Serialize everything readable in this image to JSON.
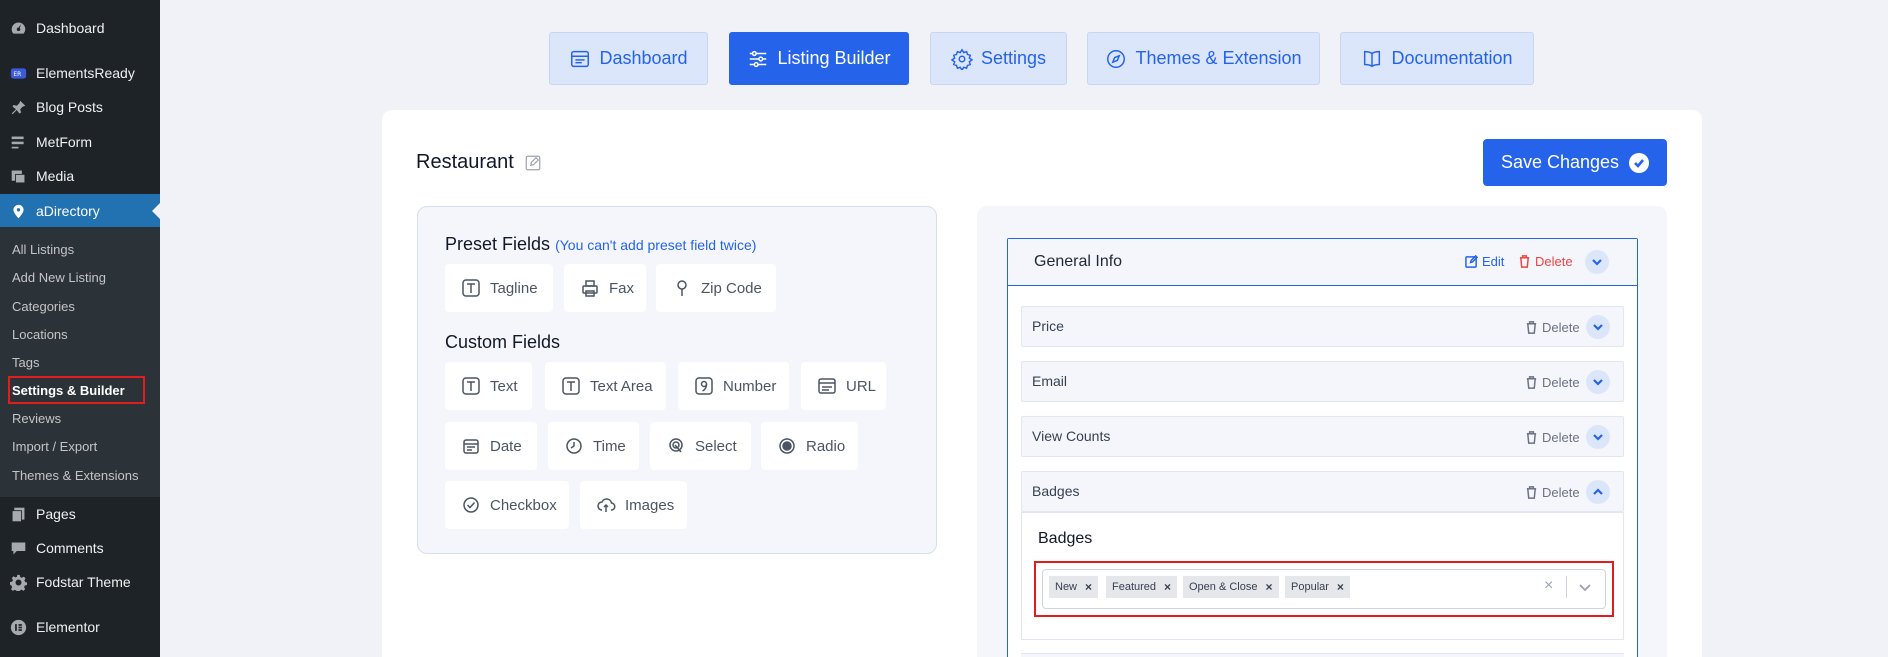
{
  "sidebar": {
    "items": [
      {
        "label": "Dashboard",
        "icon": "dashboard-icon"
      },
      {
        "label": "ElementsReady",
        "icon": "elementsready-icon"
      },
      {
        "label": "Blog Posts",
        "icon": "pin-icon"
      },
      {
        "label": "MetForm",
        "icon": "form-icon"
      },
      {
        "label": "Media",
        "icon": "media-icon"
      },
      {
        "label": "aDirectory",
        "icon": "location-icon"
      },
      {
        "label": "Pages",
        "icon": "pages-icon"
      },
      {
        "label": "Comments",
        "icon": "comments-icon"
      },
      {
        "label": "Fodstar Theme",
        "icon": "gear-icon"
      },
      {
        "label": "Elementor",
        "icon": "elementor-icon"
      }
    ],
    "submenu": [
      "All Listings",
      "Add New Listing",
      "Categories",
      "Locations",
      "Tags",
      "Settings & Builder",
      "Reviews",
      "Import / Export",
      "Themes & Extensions"
    ]
  },
  "topnav": {
    "tabs": [
      "Dashboard",
      "Listing Builder",
      "Settings",
      "Themes & Extension",
      "Documentation"
    ]
  },
  "builder": {
    "title": "Restaurant",
    "save_label": "Save Changes",
    "preset": {
      "heading": "Preset Fields",
      "note": "(You can't add preset field twice)",
      "chips": [
        "Tagline",
        "Fax",
        "Zip Code"
      ]
    },
    "custom": {
      "heading": "Custom Fields",
      "chips": [
        "Text",
        "Text Area",
        "Number",
        "URL",
        "Date",
        "Time",
        "Select",
        "Radio",
        "Checkbox",
        "Images"
      ]
    },
    "group": {
      "title": "General Info",
      "edit_label": "Edit",
      "delete_label": "Delete",
      "fields": [
        "Price",
        "Email",
        "View Counts",
        "Badges"
      ],
      "field_delete_label": "Delete",
      "badges": {
        "title": "Badges",
        "tags": [
          "New",
          "Featured",
          "Open & Close",
          "Popular"
        ]
      }
    }
  }
}
